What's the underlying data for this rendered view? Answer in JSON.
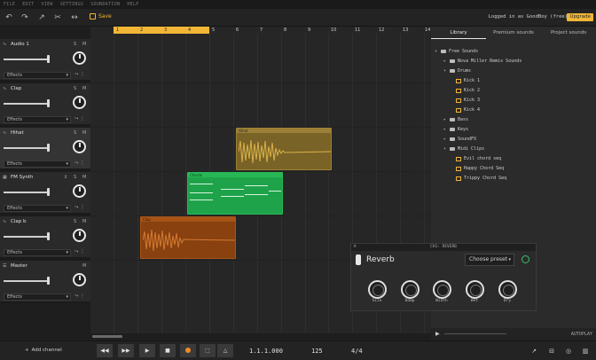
{
  "menu": [
    "FILE",
    "EDIT",
    "VIEW",
    "SETTINGS",
    "SOUNDATION",
    "HELP"
  ],
  "toolbar": {
    "save_label": "Save",
    "login_text": "Logged in as GoodBoy (free)",
    "upgrade_label": "Upgrade"
  },
  "ruler": {
    "marks": [
      "1",
      "2",
      "3",
      "4",
      "5",
      "6",
      "7",
      "8",
      "9",
      "10",
      "11",
      "12",
      "13",
      "14"
    ]
  },
  "tracks": [
    {
      "name": "Audio 1",
      "effects_label": "Effects"
    },
    {
      "name": "Clap",
      "effects_label": "Effects"
    },
    {
      "name": "Hihat",
      "effects_label": "Effects"
    },
    {
      "name": "FM Synth",
      "effects_label": "Effects"
    },
    {
      "name": "Clap b",
      "effects_label": "Effects"
    },
    {
      "name": "Master",
      "effects_label": "Effects"
    }
  ],
  "clips": [
    {
      "label": "Hihat",
      "color": "#9c8036"
    },
    {
      "label": "Chords",
      "color": "#27b855"
    },
    {
      "label": "Clap",
      "color": "#a85418"
    }
  ],
  "library": {
    "tabs": [
      "Library",
      "Premium sounds",
      "Project sounds"
    ],
    "items": [
      "Free Sounds",
      "Nova Miller Remix Sounds",
      "Drums",
      "Kick 1",
      "Kick 2",
      "Kick 3",
      "Kick 4",
      "Bass",
      "Keys",
      "SoundFX",
      "Midi Clips",
      "Evil chord seq",
      "Happy Chord Seq",
      "Trippy Chord Seq"
    ],
    "autoplay_label": "AUTOPLAY"
  },
  "plugin": {
    "window_title": "CH1: REVERB",
    "name": "Reverb",
    "preset_label": "Choose preset",
    "knobs": [
      "Size",
      "Damp",
      "Width",
      "Wet",
      "Dry"
    ]
  },
  "transport": {
    "add_channel_label": "Add channel",
    "position": "1.1.1.000",
    "tempo": "125",
    "time_signature": "4/4"
  },
  "colors": {
    "accent": "#f2b636",
    "record": "#f08a24",
    "power": "#39c06a"
  }
}
